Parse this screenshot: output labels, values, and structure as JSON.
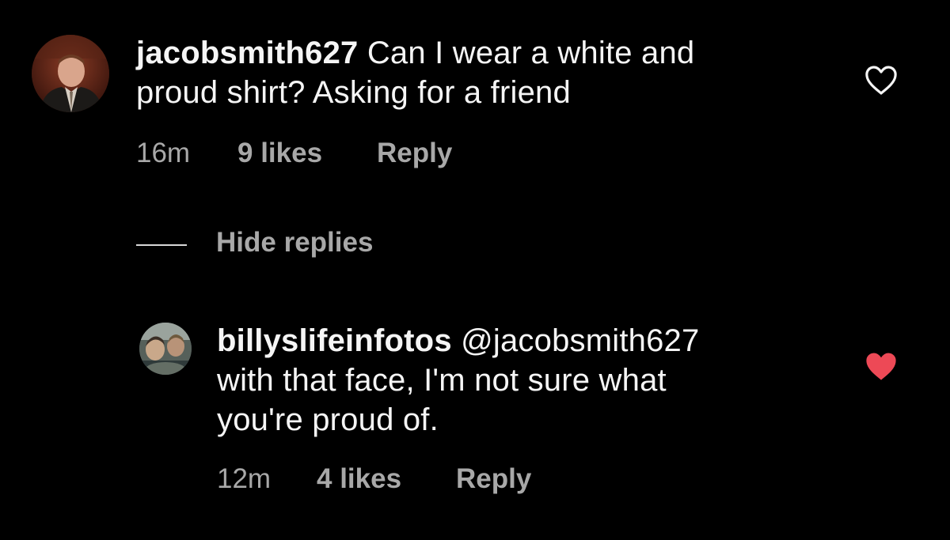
{
  "comments": [
    {
      "username": "jacobsmith627",
      "text_line1": "Can I wear a white and",
      "text_line2": "proud shirt? Asking for a friend",
      "time": "16m",
      "likes": "9 likes",
      "reply_label": "Reply",
      "liked": false,
      "avatar_icon": "user-photo-icon"
    },
    {
      "username": "billyslifeinfotos",
      "mention": "@jacobsmith627",
      "text_line2": "with that face, I'm not sure what",
      "text_line3": "you're proud of.",
      "time": "12m",
      "likes": "4 likes",
      "reply_label": "Reply",
      "liked": true,
      "avatar_icon": "user-photo-icon"
    }
  ],
  "thread": {
    "hide_replies_label": "Hide replies"
  },
  "colors": {
    "background": "#000000",
    "text_primary": "#f5f5f5",
    "text_secondary": "#a8a8a8",
    "like_active": "#ed4956",
    "like_inactive": "#f5f5f5"
  }
}
